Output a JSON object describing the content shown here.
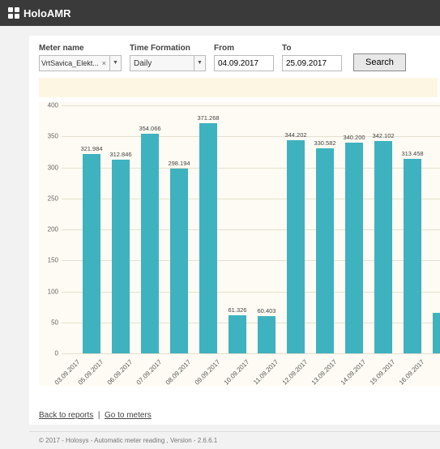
{
  "app": {
    "name": "HoloAMR"
  },
  "filters": {
    "meter_label": "Meter name",
    "meter_value": "VrtSavica_Elekt...",
    "time_label": "Time Formation",
    "time_value": "Daily",
    "from_label": "From",
    "from_value": "04.09.2017",
    "to_label": "To",
    "to_value": "25.09.2017",
    "search": "Search"
  },
  "links": {
    "back": "Back to reports",
    "meters": "Go to meters"
  },
  "footer": "© 2017 - Holosys - Automatic meter reading , Version - 2.6.6.1",
  "chart_data": {
    "type": "bar",
    "ylim": [
      0,
      400
    ],
    "yticks": [
      0,
      50,
      100,
      150,
      200,
      250,
      300,
      350,
      400
    ],
    "x_first_tick": "03.09.2017",
    "categories": [
      "05.09.2017",
      "06.09.2017",
      "07.09.2017",
      "08.09.2017",
      "09.09.2017",
      "10.09.2017",
      "11.09.2017",
      "12.09.2017",
      "13.09.2017",
      "14.09.2017",
      "15.09.2017",
      "16.09.2017"
    ],
    "values": [
      321.984,
      312.846,
      354.066,
      298.194,
      371.268,
      61.326,
      60.403,
      344.202,
      330.582,
      340.2,
      342.102,
      313.458
    ],
    "trailing_partial": 65
  }
}
